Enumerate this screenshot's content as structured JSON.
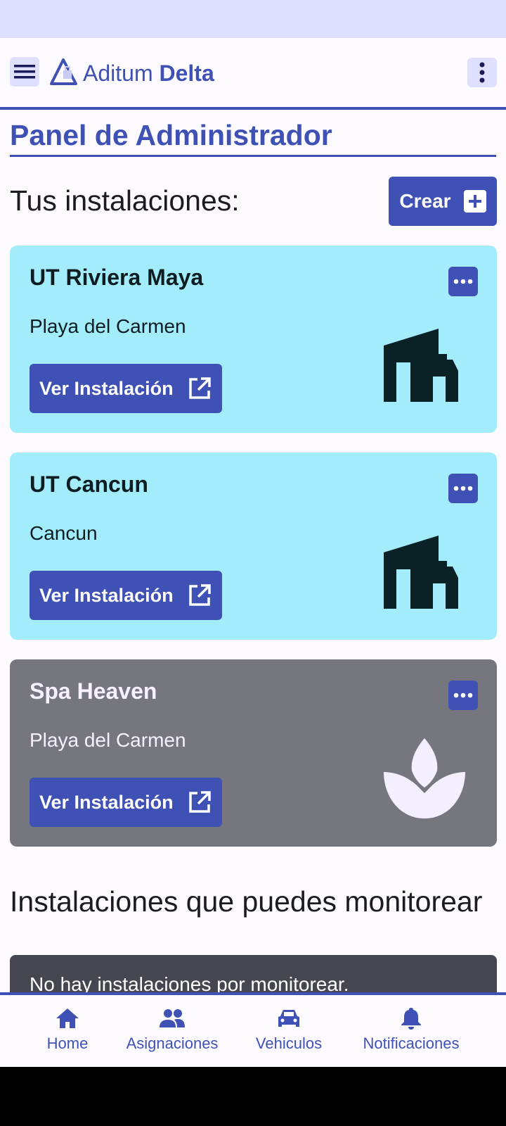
{
  "app": {
    "brand_light": "Aditum",
    "brand_bold": "Delta"
  },
  "page": {
    "title": "Panel de Administrador",
    "installations_heading": "Tus instalaciones:",
    "create_label": "Crear",
    "monitor_heading": "Instalaciones que puedes monitorear",
    "empty_monitor": "No hay instalaciones por monitorear."
  },
  "installations": [
    {
      "name": "UT Riviera Maya",
      "city": "Playa del Carmen",
      "button": "Ver Instalación",
      "icon": "building-icon",
      "status": "active"
    },
    {
      "name": "UT Cancun",
      "city": "Cancun",
      "button": "Ver Instalación",
      "icon": "building-icon",
      "status": "active"
    },
    {
      "name": "Spa Heaven",
      "city": "Playa del Carmen",
      "button": "Ver Instalación",
      "icon": "spa-lotus-icon",
      "status": "inactive"
    }
  ],
  "nav": [
    {
      "label": "Home",
      "icon": "home-icon"
    },
    {
      "label": "Asignaciones",
      "icon": "people-icon"
    },
    {
      "label": "Vehiculos",
      "icon": "car-icon"
    },
    {
      "label": "Notificaciones",
      "icon": "bell-icon"
    }
  ],
  "colors": {
    "primary": "#3f51b5",
    "active_card": "#a2ecfb",
    "inactive_card": "#76767f",
    "statusbar": "#dfe0ff"
  }
}
